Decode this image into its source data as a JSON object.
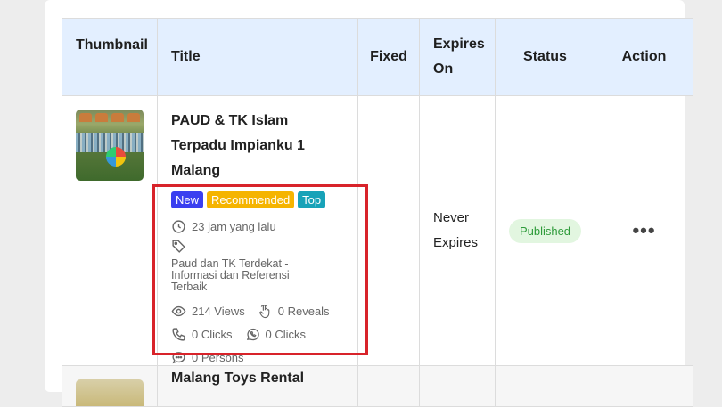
{
  "table": {
    "headers": {
      "thumbnail": "Thumbnail",
      "title": "Title",
      "fixed": "Fixed",
      "expires": "Expires On",
      "status": "Status",
      "action": "Action"
    },
    "rows": [
      {
        "title": "PAUD & TK Islam Terpadu Impianku 1 Malang",
        "badges": {
          "new": "New",
          "recommended": "Recommended",
          "top": "Top"
        },
        "time": "23 jam yang lalu",
        "tag": "Paud dan TK Terdekat - Informasi dan Referensi Terbaik",
        "views": "214 Views",
        "reveals": "0 Reveals",
        "phone_clicks": "0 Clicks",
        "whatsapp_clicks": "0 Clicks",
        "persons": "0 Persons",
        "expires": "Never Expires",
        "status": "Published",
        "action": "•••"
      },
      {
        "title": "Malang Toys Rental"
      }
    ]
  },
  "colors": {
    "header_bg": "#e3efff",
    "badge_new": "#3a3ff0",
    "badge_recommended": "#f5b400",
    "badge_top": "#17a2b8",
    "status_published": "#2e9b3a",
    "highlight": "#d8232a"
  }
}
